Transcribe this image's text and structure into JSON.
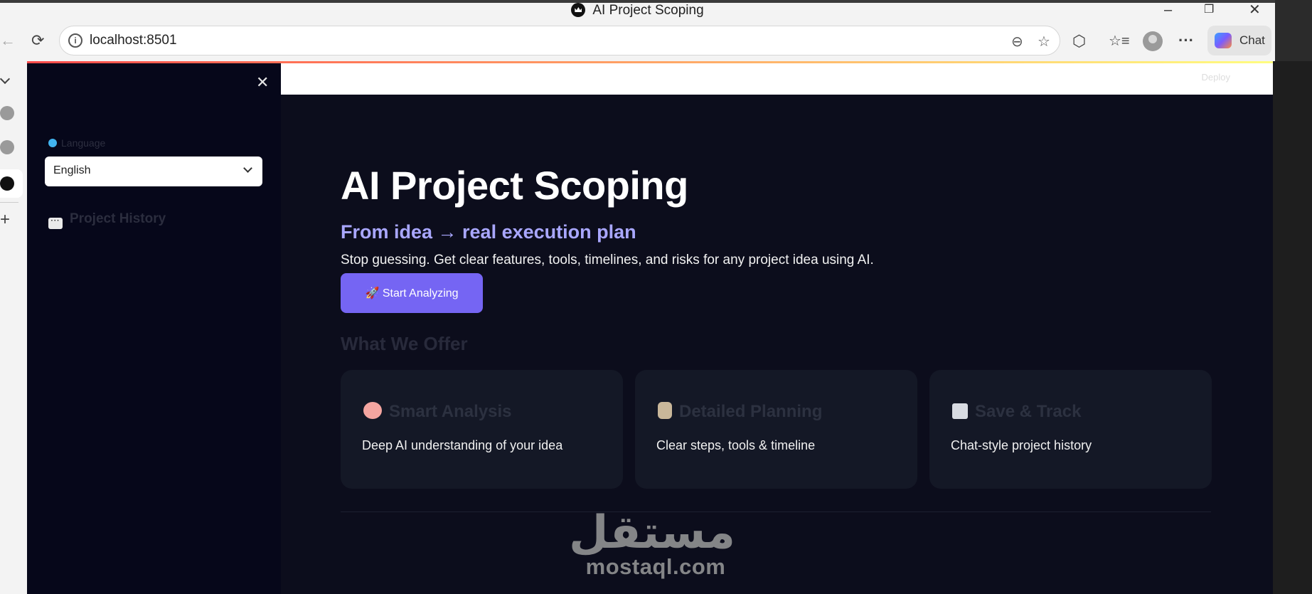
{
  "browser": {
    "window_title": "AI Project Scoping",
    "address": "localhost:8501",
    "chat_label": "Chat",
    "window_controls": {
      "minimize": "–",
      "restore": "❐",
      "close": "✕"
    },
    "nav_icons": {
      "back": "←",
      "refresh": "⟳"
    },
    "toolbar_icons": {
      "zoom": "⊖",
      "favorite": "☆",
      "extensions": "⬡",
      "favorites": "☆≡",
      "more": "···"
    }
  },
  "vertical_tabs": {
    "collapse_icon": "chevron-down-icon",
    "new_tab": "+"
  },
  "sidebar": {
    "close": "✕",
    "language_label": "Language",
    "language_value": "English",
    "history_title": "Project History",
    "history_icon_text": "···"
  },
  "header": {
    "deploy_label": "Deploy"
  },
  "main": {
    "title": "AI Project Scoping",
    "subtitle": "From idea → real execution plan",
    "description": "Stop guessing. Get clear features, tools, timelines, and risks for any project idea using AI.",
    "cta_label": "🚀 Start Analyzing",
    "offer_heading": "What We Offer",
    "cards": [
      {
        "icon": "brain-icon",
        "title": "Smart Analysis",
        "desc": "Deep AI understanding of your idea",
        "color": "#f4a5a0"
      },
      {
        "icon": "clipboard-icon",
        "title": "Detailed Planning",
        "desc": "Clear steps, tools & timeline",
        "color": "#c9b79a"
      },
      {
        "icon": "floppy-icon",
        "title": "Save & Track",
        "desc": "Chat-style project history",
        "color": "#d8dbe2"
      }
    ]
  },
  "watermark": {
    "arabic": "مستقل",
    "latin": "mostaql.com"
  },
  "colors": {
    "accent": "#7565f3",
    "subtitle": "#a9a7ff",
    "app_bg": "#0c0d1c"
  }
}
